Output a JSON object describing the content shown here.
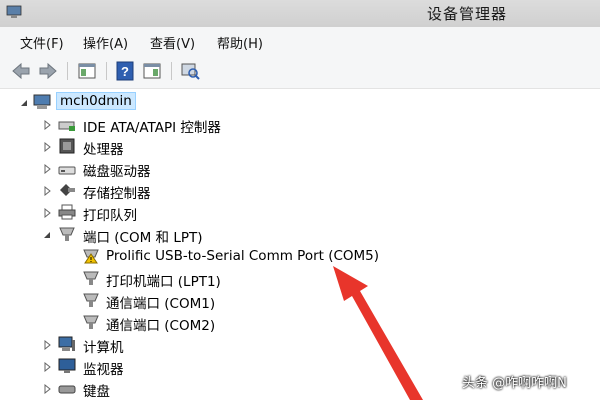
{
  "window": {
    "title": "设备管理器"
  },
  "menu": [
    "文件(F)",
    "操作(A)",
    "查看(V)",
    "帮助(H)"
  ],
  "toolbar": {
    "buttons": [
      "back-icon",
      "forward-icon",
      "properties-panel-icon",
      "help-icon",
      "show-hide-icon",
      "scan-hardware-icon"
    ]
  },
  "tree": {
    "root": "mch0dmin",
    "categories": [
      {
        "label": "IDE ATA/ATAPI 控制器",
        "icon": "ide-controller-icon",
        "expanded": false
      },
      {
        "label": "处理器",
        "icon": "processor-icon",
        "expanded": false
      },
      {
        "label": "磁盘驱动器",
        "icon": "disk-drive-icon",
        "expanded": false
      },
      {
        "label": "存储控制器",
        "icon": "storage-controller-icon",
        "expanded": false
      },
      {
        "label": "打印队列",
        "icon": "printer-icon",
        "expanded": false
      },
      {
        "label": "端口 (COM 和 LPT)",
        "icon": "port-icon",
        "expanded": true
      },
      {
        "label": "计算机",
        "icon": "computer-icon",
        "expanded": false
      },
      {
        "label": "监视器",
        "icon": "monitor-icon",
        "expanded": false
      },
      {
        "label": "键盘",
        "icon": "keyboard-icon",
        "expanded": false
      }
    ],
    "ports": [
      {
        "label": "Prolific USB-to-Serial Comm Port (COM5)",
        "warning": true
      },
      {
        "label": "打印机端口 (LPT1)",
        "warning": false
      },
      {
        "label": "通信端口 (COM1)",
        "warning": false
      },
      {
        "label": "通信端口 (COM2)",
        "warning": false
      }
    ]
  },
  "watermark": "头条 @咋啊咋啊N",
  "colors": {
    "annotation_arrow": "#e8352b",
    "selection": "#cce8ff"
  }
}
